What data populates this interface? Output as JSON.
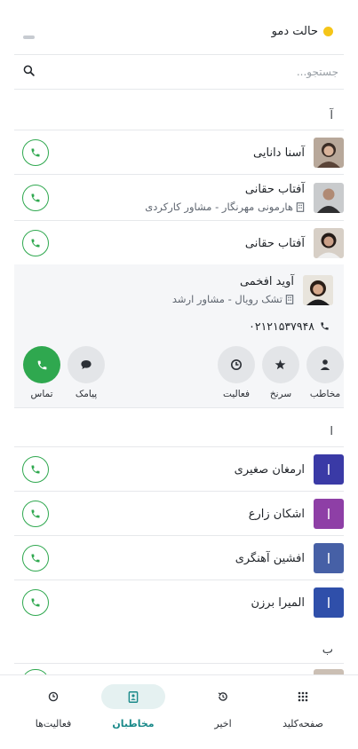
{
  "header": {
    "demo_mode": "حالت دمو"
  },
  "search": {
    "placeholder": "جستجو..."
  },
  "sections": [
    "آ",
    "ا",
    "ب"
  ],
  "contacts_a": [
    {
      "name": "آسنا دانایی"
    },
    {
      "name": "آفتاب حقانی",
      "company": "هارمونی مهرنگار - مشاور کارکردی"
    },
    {
      "name": "آفتاب حقانی"
    }
  ],
  "expanded": {
    "name": "آوید افخمی",
    "company": "تشک رویال - مشاور ارشد",
    "phone": "۰۲۱۲۱۵۳۷۹۴۸",
    "actions": {
      "contact": "مخاطب",
      "favorite": "سرنخ",
      "activity": "فعالیت",
      "sms": "پیامک",
      "call": "تماس"
    }
  },
  "contacts_alef": [
    {
      "name": "ارمغان صغیری",
      "badge": "ا",
      "color": "#3a3aa6"
    },
    {
      "name": "اشکان زارع",
      "badge": "ا",
      "color": "#8e3fa6"
    },
    {
      "name": "افشین آهنگری",
      "badge": "ا",
      "color": "#4660a6"
    },
    {
      "name": "المیرا برزن",
      "badge": "ا",
      "color": "#2f4faa"
    }
  ],
  "nav": {
    "keypad": "صفحه‌کلید",
    "recent": "اخیر",
    "contacts": "مخاطبان",
    "activities": "فعالیت‌ها"
  },
  "colors": {
    "accent": "#2fa84f",
    "active_nav": "#1a8a8a",
    "demo_dot": "#f5c518"
  }
}
